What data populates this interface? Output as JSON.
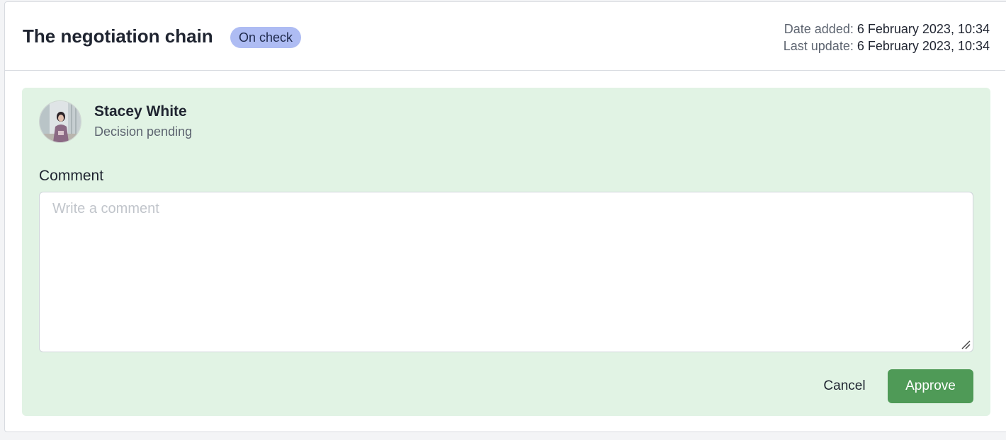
{
  "header": {
    "title": "The negotiation chain",
    "status_badge": "On check",
    "date_added_label": "Date added:",
    "date_added_value": "6 February 2023, 10:34",
    "last_update_label": "Last update:",
    "last_update_value": "6 February 2023, 10:34"
  },
  "approver": {
    "name": "Stacey White",
    "status": "Decision pending",
    "avatar_icon": "user-photo-avatar"
  },
  "comment": {
    "label": "Comment",
    "placeholder": "Write a comment",
    "value": ""
  },
  "actions": {
    "cancel_label": "Cancel",
    "approve_label": "Approve"
  },
  "colors": {
    "badge_bg": "#aebcf3",
    "panel_bg": "#e1f3e4",
    "approve_bg": "#4f9a57"
  }
}
